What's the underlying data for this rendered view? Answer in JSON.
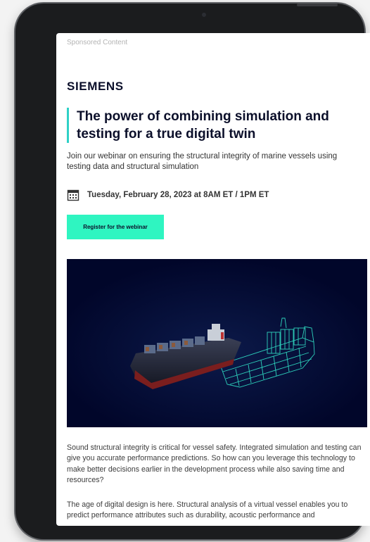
{
  "header": {
    "sponsored_label": "Sponsored Content",
    "brand": "SIEMENS"
  },
  "article": {
    "headline": "The power of combining simulation and testing for a true digital twin",
    "intro": "Join our webinar on ensuring the structural integrity of marine vessels using testing data and structural simulation",
    "date": "Tuesday, February 28, 2023 at 8AM ET / 1PM ET",
    "cta_label": "Register for the webinar",
    "paragraph_1": "Sound structural integrity is critical for vessel safety. Integrated simulation and testing can give you accurate performance predictions. So how can you leverage this technology to make better decisions earlier in the development process while also saving time and resources?",
    "paragraph_2": "The age of digital design is here. Structural analysis of a virtual vessel enables you to predict performance attributes such as durability, acoustic performance and"
  },
  "icons": {
    "calendar": "calendar-icon"
  },
  "colors": {
    "accent_bar": "#2fd1c6",
    "cta_background": "#2ff5c1",
    "brand_text": "#0b0f2a",
    "hero_background": "#01062a",
    "wireframe": "#32e6c9"
  }
}
